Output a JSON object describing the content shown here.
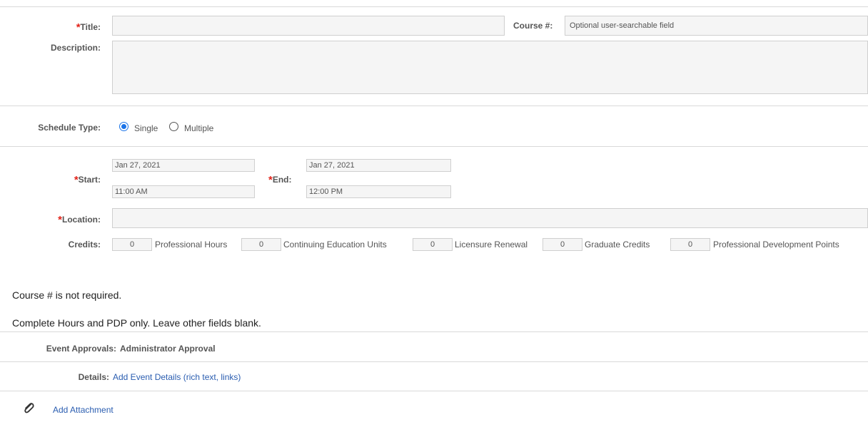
{
  "form": {
    "title_label": "Title:",
    "title_value": "",
    "course_label": "Course #:",
    "course_placeholder": "Optional user-searchable field",
    "description_label": "Description:",
    "description_value": "",
    "required_marker": "*"
  },
  "schedule": {
    "label": "Schedule Type:",
    "options": [
      {
        "label": "Single",
        "selected": true
      },
      {
        "label": "Multiple",
        "selected": false
      }
    ]
  },
  "datetime": {
    "start_label": "Start:",
    "start_date": "Jan 27, 2021",
    "start_time": "11:00 AM",
    "end_label": "End:",
    "end_date": "Jan 27, 2021",
    "end_time": "12:00 PM"
  },
  "location": {
    "label": "Location:",
    "value": ""
  },
  "credits": {
    "label": "Credits:",
    "items": [
      {
        "value": "0",
        "name": "Professional Hours"
      },
      {
        "value": "0",
        "name": "Continuing Education Units"
      },
      {
        "value": "0",
        "name": "Licensure Renewal"
      },
      {
        "value": "0",
        "name": "Graduate Credits"
      },
      {
        "value": "0",
        "name": "Professional Development Points"
      }
    ]
  },
  "notes": {
    "line1": "Course # is not required.",
    "line2": "Complete Hours and PDP only. Leave other fields blank."
  },
  "approvals": {
    "label": "Event Approvals:",
    "value": "Administrator Approval"
  },
  "details": {
    "label": "Details:",
    "link": "Add Event Details (rich text, links)"
  },
  "attachment": {
    "icon": "paperclip-icon",
    "link": "Add Attachment"
  },
  "colors": {
    "required": "#e2231a",
    "link": "#2a5db0",
    "radio_selected": "#1a73e8"
  }
}
